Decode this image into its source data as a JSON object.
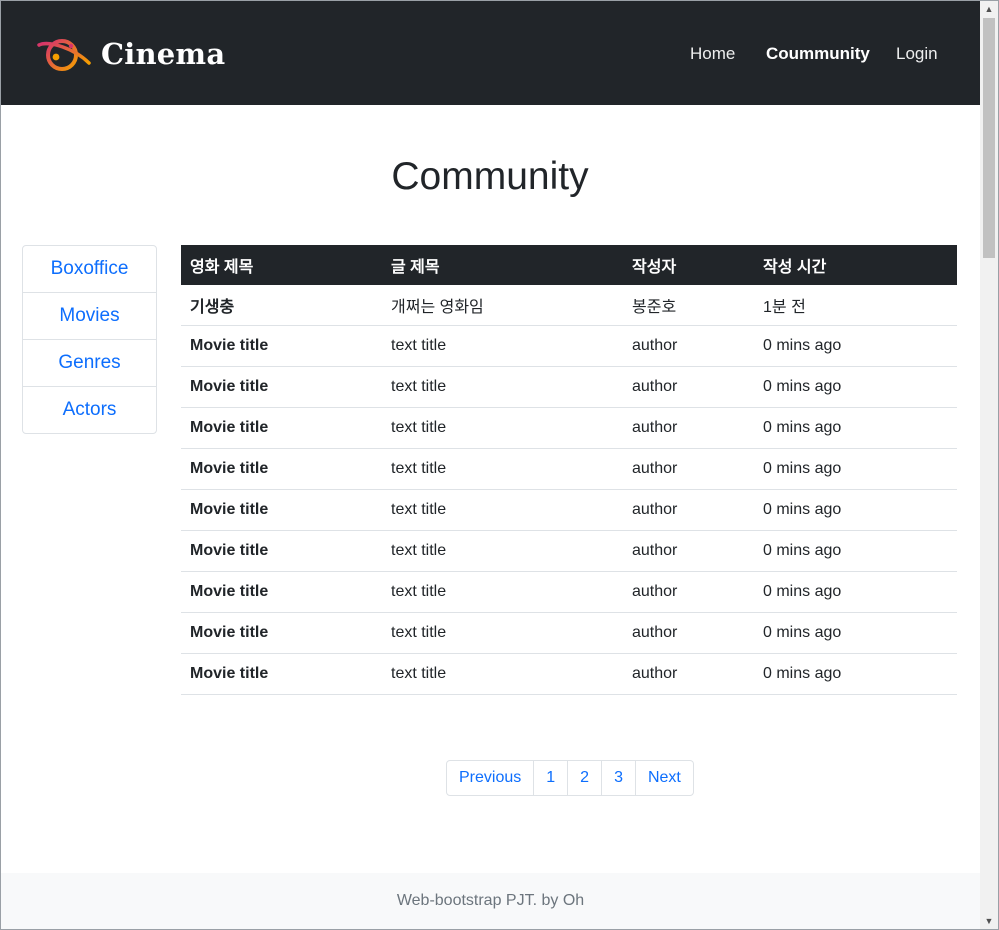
{
  "navbar": {
    "brand": "Cinema",
    "links": [
      {
        "label": "Home",
        "active": false
      },
      {
        "label": "Coummunity",
        "active": true
      },
      {
        "label": "Login",
        "active": false
      }
    ]
  },
  "page_title": "Community",
  "sidebar": {
    "items": [
      "Boxoffice",
      "Movies",
      "Genres",
      "Actors"
    ]
  },
  "table": {
    "headers": [
      "영화 제목",
      "글 제목",
      "작성자",
      "작성 시간"
    ],
    "rows": [
      [
        "기생충",
        "개쩌는 영화임",
        "봉준호",
        "1분 전"
      ],
      [
        "Movie title",
        "text title",
        "author",
        "0 mins ago"
      ],
      [
        "Movie title",
        "text title",
        "author",
        "0 mins ago"
      ],
      [
        "Movie title",
        "text title",
        "author",
        "0 mins ago"
      ],
      [
        "Movie title",
        "text title",
        "author",
        "0 mins ago"
      ],
      [
        "Movie title",
        "text title",
        "author",
        "0 mins ago"
      ],
      [
        "Movie title",
        "text title",
        "author",
        "0 mins ago"
      ],
      [
        "Movie title",
        "text title",
        "author",
        "0 mins ago"
      ],
      [
        "Movie title",
        "text title",
        "author",
        "0 mins ago"
      ],
      [
        "Movie title",
        "text title",
        "author",
        "0 mins ago"
      ]
    ]
  },
  "pagination": {
    "previous": "Previous",
    "pages": [
      "1",
      "2",
      "3"
    ],
    "next": "Next"
  },
  "footer": {
    "text": "Web-bootstrap PJT. by Oh"
  },
  "colors": {
    "navbar_bg": "#212529",
    "link_blue": "#0d6efd",
    "footer_bg": "#f8f9fa"
  }
}
